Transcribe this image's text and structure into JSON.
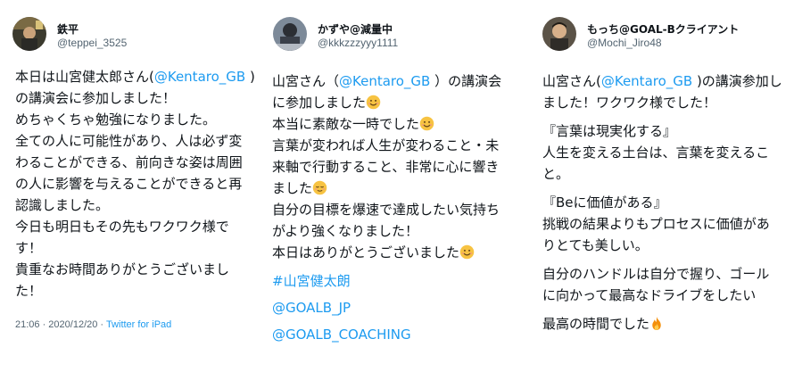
{
  "tweets": [
    {
      "name": "鉄平",
      "handle": "@teppei_3525",
      "lines": {
        "l1a": "本日は山宮健太郎さん(",
        "l1b": "@Kentaro_GB",
        "l1c": " )",
        "l2": "の講演会に参加しました！",
        "l3": "めちゃくちゃ勉強になりました。",
        "l4": "全ての人に可能性があり、人は必ず変",
        "l5": "わることができる、前向きな姿は周囲",
        "l6": "の人に影響を与えることができると再",
        "l7": "認識しました。",
        "l8": "今日も明日もその先もワクワク様で",
        "l9": "す！",
        "l10": "貴重なお時間ありがとうございまし",
        "l11": "た！"
      },
      "time": "21:06 · 2020/12/20 · ",
      "source": "Twitter for iPad"
    },
    {
      "name": "かずや@減量中",
      "handle": "@kkkzzzyyy1111",
      "lines": {
        "l1a": "山宮さん（",
        "l1b": "@Kentaro_GB",
        "l1c": " ）の講演会",
        "l2": "に参加しました",
        "l3": "本当に素敵な一時でした",
        "l4": "言葉が変われば人生が変わること・未",
        "l5": "来軸で行動すること、非常に心に響き",
        "l6": "ました",
        "l7": "自分の目標を爆速で達成したい気持ち",
        "l8": "がより強くなりました！",
        "l9": "本日はありがとうございました",
        "h1": "#山宮健太朗",
        "h2": "@GOALB_JP",
        "h3": "@GOALB_COACHING"
      }
    },
    {
      "name": "もっち@GOAL-Bクライアント",
      "handle": "@Mochi_Jiro48",
      "lines": {
        "l1a": "山宮さん(",
        "l1b": "@Kentaro_GB",
        "l1c": " )の講演参加し",
        "l2": "ました！ワクワク様でした！",
        "l3": "『言葉は現実化する』",
        "l4": "人生を変える土台は、言葉を変えるこ",
        "l5": "と。",
        "l6": "『Beに価値がある』",
        "l7": "挑戦の結果よりもプロセスに価値があ",
        "l8": "りとても美しい。",
        "l9": "自分のハンドルは自分で握り、ゴール",
        "l10": "に向かって最高なドライブをしたい",
        "l11": "最高の時間でした"
      }
    }
  ],
  "icons": {
    "smile": "smiling-face-emoji",
    "relieved": "relieved-face-emoji",
    "fire": "fire-emoji"
  },
  "colors": {
    "link": "#1d9bf0",
    "secondary": "#536471",
    "text": "#0f1419"
  }
}
